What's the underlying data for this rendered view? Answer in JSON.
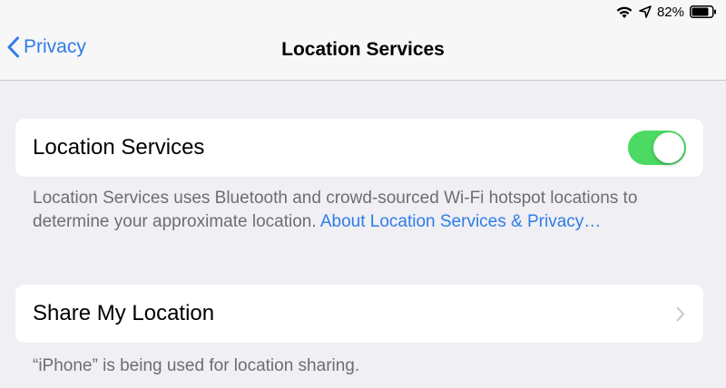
{
  "status_bar": {
    "battery_percent": "82%",
    "icons": [
      "wifi-icon",
      "location-arrow-icon",
      "battery-icon"
    ],
    "battery_level": 0.82
  },
  "nav": {
    "back_label": "Privacy",
    "title": "Location Services"
  },
  "location_services": {
    "label": "Location Services",
    "toggle_on": true,
    "footer_text": "Location Services uses Bluetooth and crowd-sourced Wi-Fi hotspot locations to determine your approximate location. ",
    "footer_link": "About Location Services & Privacy…"
  },
  "share_my_location": {
    "label": "Share My Location",
    "footer_text": "“iPhone” is being used for location sharing."
  },
  "colors": {
    "accent": "#2f7ce8",
    "toggle_on": "#4cd964",
    "background": "#efeff4",
    "secondary_text": "#6d6d72"
  }
}
